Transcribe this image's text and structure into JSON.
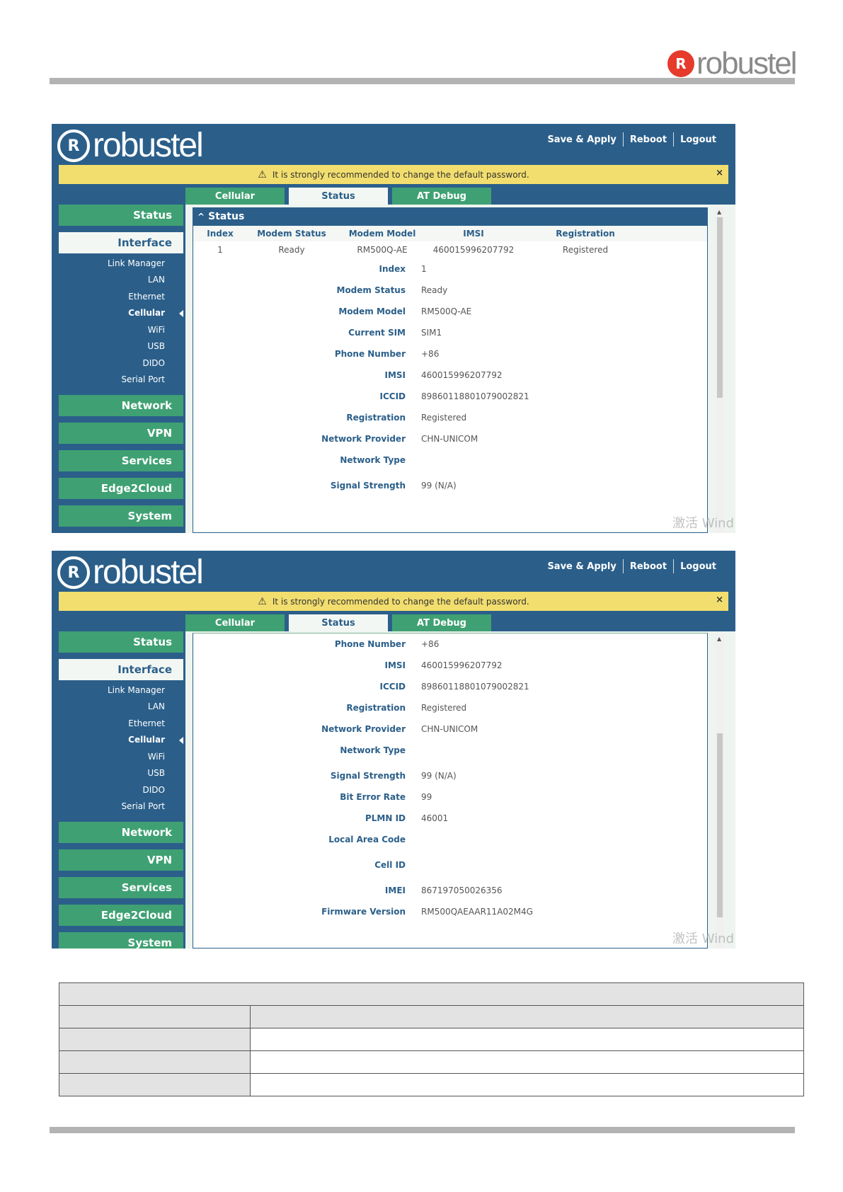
{
  "doc": {
    "logo_text": "robustel"
  },
  "ui": {
    "brand_text": "robustel",
    "topnav": [
      "Save & Apply",
      "Reboot",
      "Logout"
    ],
    "warning": "It is strongly recommended to change the default password.",
    "warning_close": "×",
    "tabs": [
      "Cellular",
      "Status",
      "AT Debug"
    ],
    "sidebar": {
      "status": "Status",
      "interface": "Interface",
      "interface_items": [
        "Link Manager",
        "LAN",
        "Ethernet",
        "Cellular",
        "WiFi",
        "USB",
        "DIDO",
        "Serial Port"
      ],
      "network": "Network",
      "vpn": "VPN",
      "services": "Services",
      "edge2cloud": "Edge2Cloud",
      "system": "System"
    },
    "watermark": "激活 Wind"
  },
  "shot1": {
    "panel_title": "Status",
    "columns": [
      "Index",
      "Modem Status",
      "Modem Model",
      "IMSI",
      "Registration"
    ],
    "row": [
      "1",
      "Ready",
      "RM500Q-AE",
      "460015996207792",
      "Registered"
    ],
    "details": [
      {
        "k": "Index",
        "v": "1"
      },
      {
        "k": "Modem Status",
        "v": "Ready"
      },
      {
        "k": "Modem Model",
        "v": "RM500Q-AE"
      },
      {
        "k": "Current SIM",
        "v": "SIM1"
      },
      {
        "k": "Phone Number",
        "v": "+86"
      },
      {
        "k": "IMSI",
        "v": "460015996207792"
      },
      {
        "k": "ICCID",
        "v": "89860118801079002821"
      },
      {
        "k": "Registration",
        "v": "Registered"
      },
      {
        "k": "Network Provider",
        "v": "CHN-UNICOM"
      },
      {
        "k": "Network Type",
        "v": ""
      },
      {
        "k": "Signal Strength",
        "v": "99 (N/A)"
      }
    ]
  },
  "shot2": {
    "details": [
      {
        "k": "Phone Number",
        "v": "+86"
      },
      {
        "k": "IMSI",
        "v": "460015996207792"
      },
      {
        "k": "ICCID",
        "v": "89860118801079002821"
      },
      {
        "k": "Registration",
        "v": "Registered"
      },
      {
        "k": "Network Provider",
        "v": "CHN-UNICOM"
      },
      {
        "k": "Network Type",
        "v": ""
      },
      {
        "k": "Signal Strength",
        "v": "99 (N/A)"
      },
      {
        "k": "Bit Error Rate",
        "v": "99"
      },
      {
        "k": "PLMN ID",
        "v": "46001"
      },
      {
        "k": "Local Area Code",
        "v": ""
      },
      {
        "k": "Cell ID",
        "v": ""
      },
      {
        "k": "IMEI",
        "v": "867197050026356"
      },
      {
        "k": "Firmware Version",
        "v": "RM500QAEAAR11A02M4G"
      }
    ]
  }
}
